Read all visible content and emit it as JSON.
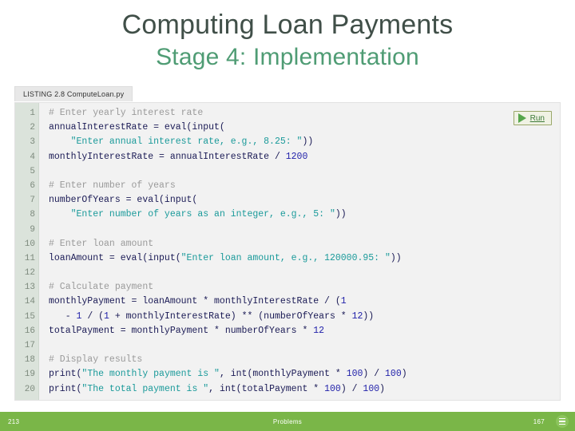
{
  "slide": {
    "title_line1": "Computing Loan Payments",
    "title_line2": "Stage 4: Implementation",
    "listing_tab": "LISTING 2.8 ComputeLoan.py"
  },
  "run": {
    "label": "Run",
    "icon": "play-icon"
  },
  "colors": {
    "title_primary": "#404f48",
    "title_accent": "#4f9c74",
    "footer_bg": "#7ab648",
    "gutter_bg": "#dbe3db",
    "code_bg": "#f2f2f2",
    "string": "#1a9a9a",
    "comment": "#9a9a9a",
    "number": "#2222aa",
    "identifier": "#1a1a55"
  },
  "code": {
    "lines": [
      {
        "n": "1",
        "tokens": [
          {
            "t": "# Enter yearly interest rate",
            "c": "tok-com"
          }
        ]
      },
      {
        "n": "2",
        "tokens": [
          {
            "t": "annualInterestRate = eval(input(",
            "c": "tok-id"
          }
        ]
      },
      {
        "n": "3",
        "tokens": [
          {
            "t": "    ",
            "c": "tok-op"
          },
          {
            "t": "\"Enter annual interest rate, e.g., 8.25: \"",
            "c": "tok-str"
          },
          {
            "t": "))",
            "c": "tok-id"
          }
        ]
      },
      {
        "n": "4",
        "tokens": [
          {
            "t": "monthlyInterestRate = annualInterestRate / ",
            "c": "tok-id"
          },
          {
            "t": "1200",
            "c": "tok-num"
          }
        ]
      },
      {
        "n": "5",
        "tokens": [
          {
            "t": "",
            "c": "tok-id"
          }
        ]
      },
      {
        "n": "6",
        "tokens": [
          {
            "t": "# Enter number of years",
            "c": "tok-com"
          }
        ]
      },
      {
        "n": "7",
        "tokens": [
          {
            "t": "numberOfYears = eval(input(",
            "c": "tok-id"
          }
        ]
      },
      {
        "n": "8",
        "tokens": [
          {
            "t": "    ",
            "c": "tok-op"
          },
          {
            "t": "\"Enter number of years as an integer, e.g., 5: \"",
            "c": "tok-str"
          },
          {
            "t": "))",
            "c": "tok-id"
          }
        ]
      },
      {
        "n": "9",
        "tokens": [
          {
            "t": "",
            "c": "tok-id"
          }
        ]
      },
      {
        "n": "10",
        "tokens": [
          {
            "t": "# Enter loan amount",
            "c": "tok-com"
          }
        ]
      },
      {
        "n": "11",
        "tokens": [
          {
            "t": "loanAmount = eval(input(",
            "c": "tok-id"
          },
          {
            "t": "\"Enter loan amount, e.g., 120000.95: \"",
            "c": "tok-str"
          },
          {
            "t": "))",
            "c": "tok-id"
          }
        ]
      },
      {
        "n": "12",
        "tokens": [
          {
            "t": "",
            "c": "tok-id"
          }
        ]
      },
      {
        "n": "13",
        "tokens": [
          {
            "t": "# Calculate payment",
            "c": "tok-com"
          }
        ]
      },
      {
        "n": "14",
        "tokens": [
          {
            "t": "monthlyPayment = loanAmount * monthlyInterestRate / (",
            "c": "tok-id"
          },
          {
            "t": "1",
            "c": "tok-num"
          }
        ]
      },
      {
        "n": "15",
        "tokens": [
          {
            "t": "   - ",
            "c": "tok-id"
          },
          {
            "t": "1",
            "c": "tok-num"
          },
          {
            "t": " / (",
            "c": "tok-id"
          },
          {
            "t": "1",
            "c": "tok-num"
          },
          {
            "t": " + monthlyInterestRate) ** (numberOfYears * ",
            "c": "tok-id"
          },
          {
            "t": "12",
            "c": "tok-num"
          },
          {
            "t": "))",
            "c": "tok-id"
          }
        ]
      },
      {
        "n": "16",
        "tokens": [
          {
            "t": "totalPayment = monthlyPayment * numberOfYears * ",
            "c": "tok-id"
          },
          {
            "t": "12",
            "c": "tok-num"
          }
        ]
      },
      {
        "n": "17",
        "tokens": [
          {
            "t": "",
            "c": "tok-id"
          }
        ]
      },
      {
        "n": "18",
        "tokens": [
          {
            "t": "# Display results",
            "c": "tok-com"
          }
        ]
      },
      {
        "n": "19",
        "tokens": [
          {
            "t": "print(",
            "c": "tok-id"
          },
          {
            "t": "\"The monthly payment is \"",
            "c": "tok-str"
          },
          {
            "t": ", int(monthlyPayment * ",
            "c": "tok-id"
          },
          {
            "t": "100",
            "c": "tok-num"
          },
          {
            "t": ") / ",
            "c": "tok-id"
          },
          {
            "t": "100",
            "c": "tok-num"
          },
          {
            "t": ")",
            "c": "tok-id"
          }
        ]
      },
      {
        "n": "20",
        "tokens": [
          {
            "t": "print(",
            "c": "tok-id"
          },
          {
            "t": "\"The total payment is \"",
            "c": "tok-str"
          },
          {
            "t": ", int(totalPayment * ",
            "c": "tok-id"
          },
          {
            "t": "100",
            "c": "tok-num"
          },
          {
            "t": ") / ",
            "c": "tok-id"
          },
          {
            "t": "100",
            "c": "tok-num"
          },
          {
            "t": ")",
            "c": "tok-id"
          }
        ]
      }
    ]
  },
  "footer": {
    "left": "213",
    "center": "Problems",
    "right": "167",
    "menu_icon": "hamburger-menu-icon"
  }
}
